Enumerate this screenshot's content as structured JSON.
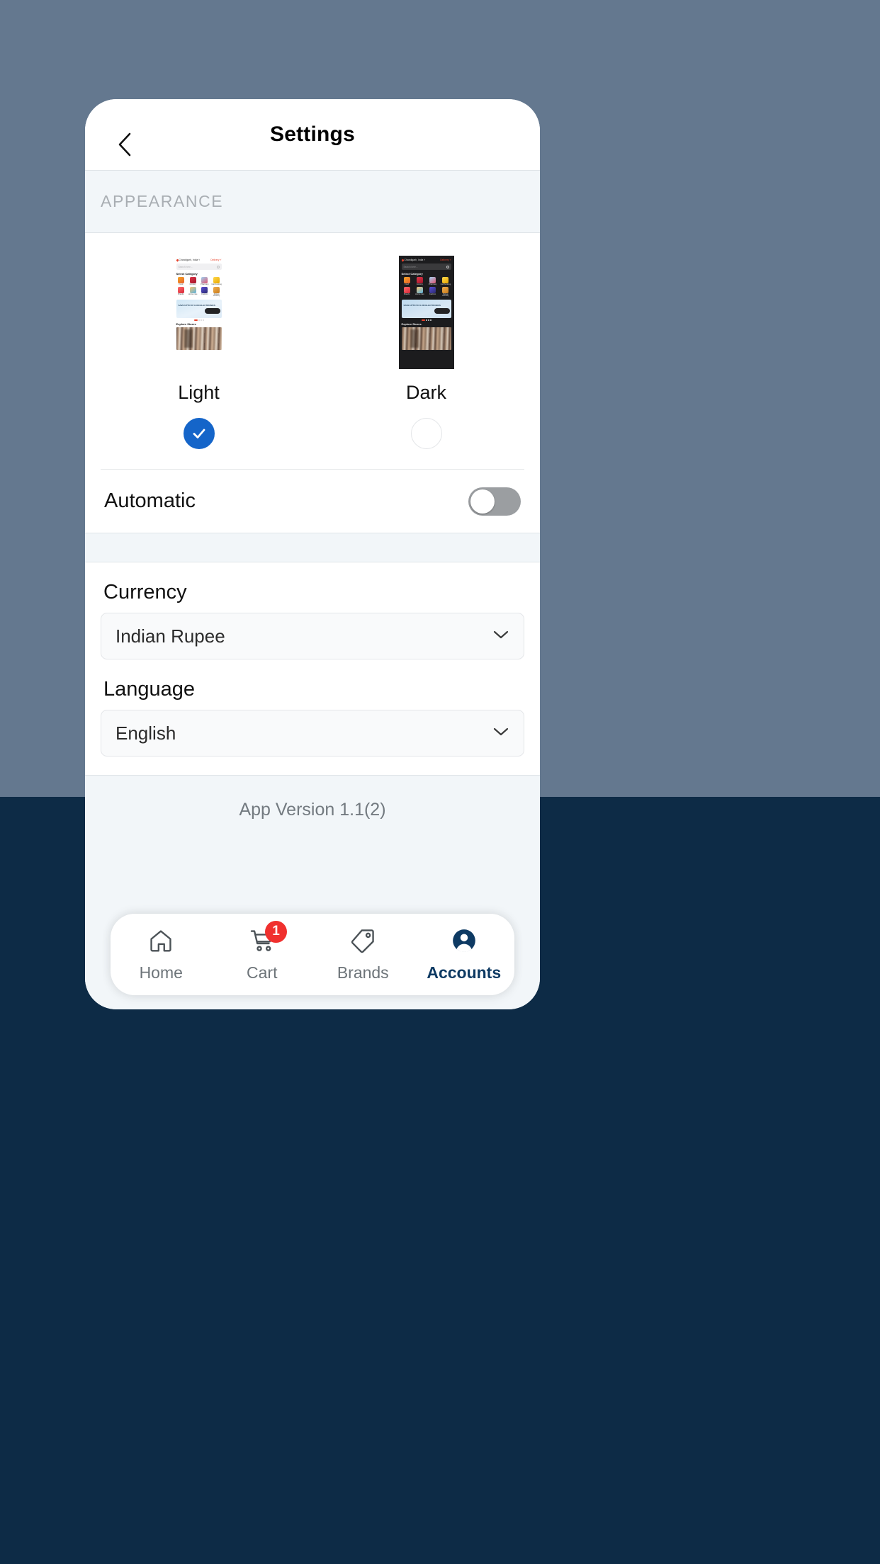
{
  "header": {
    "title": "Settings",
    "back_icon": "chevron-left-icon"
  },
  "appearance": {
    "section_label": "APPEARANCE",
    "options": [
      {
        "name": "Light",
        "selected": true
      },
      {
        "name": "Dark",
        "selected": false
      }
    ],
    "selected_color": "#1565c9",
    "automatic": {
      "label": "Automatic",
      "enabled": false
    }
  },
  "preview": {
    "location": "Chandigarh, India",
    "location_caret": "˅",
    "delivery": "Delivery",
    "delivery_caret": "˅",
    "search_placeholder": "Search here...",
    "category_heading": "Select Category",
    "categories": [
      "Food",
      "Grocery",
      "Pharmacy",
      "Cab booking",
      "Brands",
      "Home care",
      "Fashion",
      "Pickup Delivery"
    ],
    "banner_text": "SAVE UPTO 50 %\nON ELECTRONICS",
    "stores_heading": "Explore Stores"
  },
  "currency": {
    "label": "Currency",
    "value": "Indian Rupee",
    "chevron_icon": "chevron-down-icon"
  },
  "language": {
    "label": "Language",
    "value": "English",
    "chevron_icon": "chevron-down-icon"
  },
  "footer": {
    "app_version": "App Version 1.1(2)"
  },
  "bottom_nav": {
    "items": [
      {
        "label": "Home",
        "icon": "home-icon",
        "active": false,
        "badge": null
      },
      {
        "label": "Cart",
        "icon": "cart-icon",
        "active": false,
        "badge": "1"
      },
      {
        "label": "Brands",
        "icon": "tag-icon",
        "active": false,
        "badge": null
      },
      {
        "label": "Accounts",
        "icon": "person-icon",
        "active": true,
        "badge": null
      }
    ],
    "active_color": "#0e3a63",
    "badge_color": "#f0302e"
  }
}
